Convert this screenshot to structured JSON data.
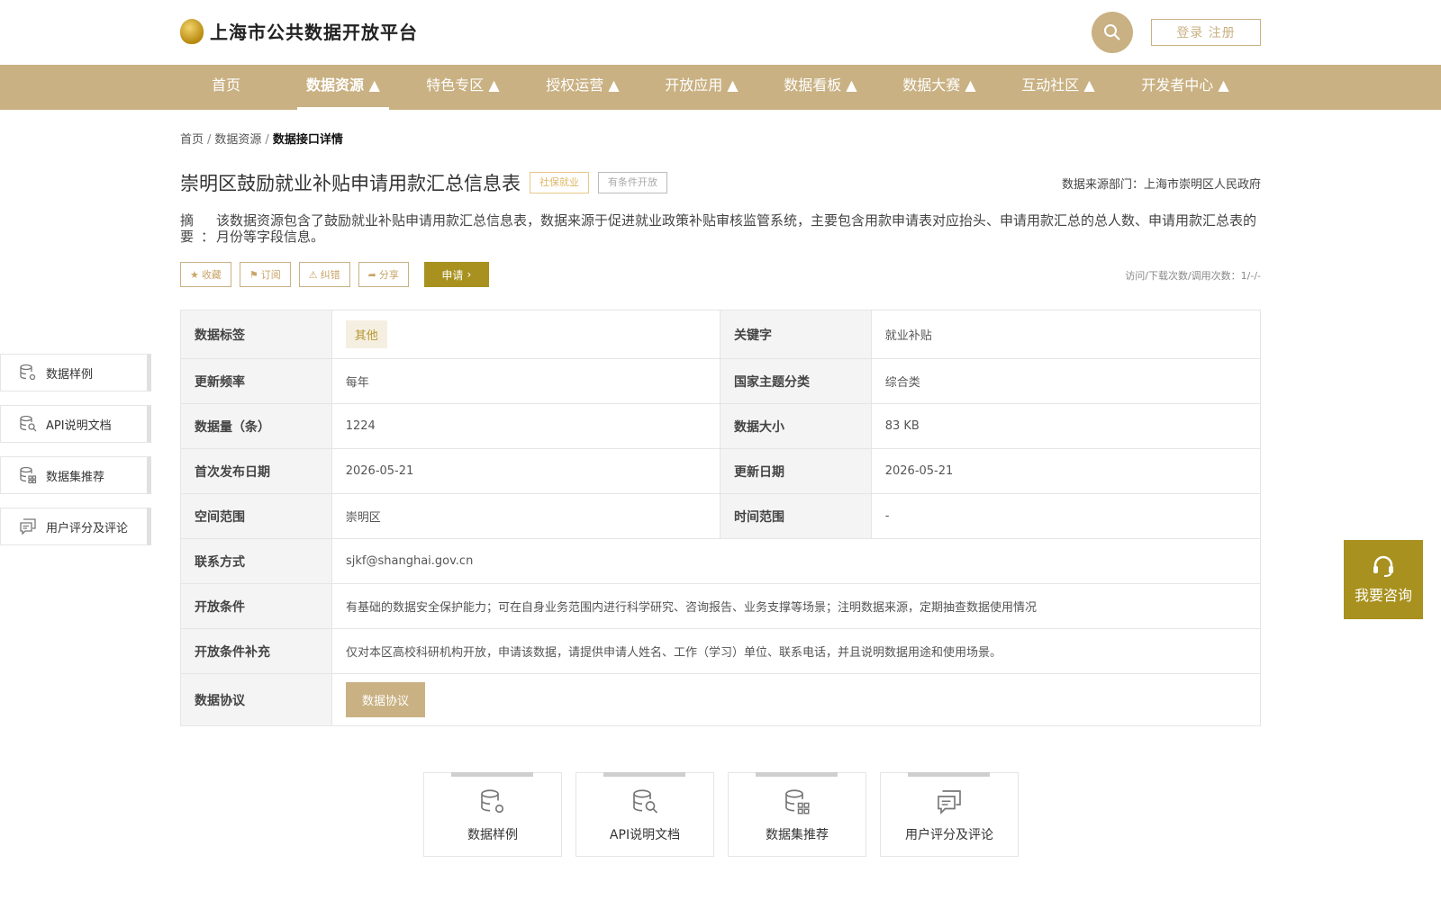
{
  "header": {
    "site_title": "上海市公共数据开放平台",
    "login_label": "登录 注册"
  },
  "nav": {
    "items": [
      {
        "label": "首页"
      },
      {
        "label": "数据资源 ▲"
      },
      {
        "label": "特色专区 ▲"
      },
      {
        "label": "授权运营 ▲"
      },
      {
        "label": "开放应用 ▲"
      },
      {
        "label": "数据看板 ▲"
      },
      {
        "label": "数据大赛 ▲"
      },
      {
        "label": "互动社区 ▲"
      },
      {
        "label": "开发者中心 ▲"
      }
    ],
    "active_index": 1
  },
  "breadcrumb": {
    "home": "首页",
    "sep": "/",
    "section": "数据资源",
    "current": "数据接口详情"
  },
  "detail": {
    "title": "崇明区鼓励就业补贴申请用款汇总信息表",
    "tag_category": "社保就业",
    "tag_open": "有条件开放",
    "source": "数据来源部门：上海市崇明区人民政府",
    "summary_label": "摘要：",
    "summary": "该数据资源包含了鼓励就业补贴申请用款汇总信息表，数据来源于促进就业政策补贴审核监管系统，主要包含用款申请表对应抬头、申请用款汇总的总人数、申请用款汇总表的月份等字段信息。"
  },
  "actions": {
    "favorite": "收藏",
    "subscribe": "订阅",
    "report": "纠错",
    "share": "分享",
    "apply": "申请",
    "stats": "访问/下载次数/调用次数：1/-/-"
  },
  "table": {
    "data_tag_label": "数据标签",
    "data_tag_value": "其他",
    "keyword_label": "关键字",
    "keyword_value": "就业补贴",
    "freq_label": "更新频率",
    "freq_value": "每年",
    "theme_label": "国家主题分类",
    "theme_value": "综合类",
    "count_label": "数据量（条）",
    "count_value": "1224",
    "size_label": "数据大小",
    "size_value": "83 KB",
    "first_pub_label": "首次发布日期",
    "first_pub_value": "2026-05-21",
    "updated_label": "更新日期",
    "updated_value": "2026-05-21",
    "space_label": "空间范围",
    "space_value": "崇明区",
    "time_label": "时间范围",
    "time_value": "-",
    "contact_label": "联系方式",
    "contact_value": "sjkf@shanghai.gov.cn",
    "cond_label": "开放条件",
    "cond_value": "有基础的数据安全保护能力；可在自身业务范围内进行科学研究、咨询报告、业务支撑等场景；注明数据来源，定期抽查数据使用情况",
    "cond_extra_label": "开放条件补充",
    "cond_extra_value": "仅对本区高校科研机构开放，申请该数据，请提供申请人姓名、工作（学习）单位、联系电话，并且说明数据用途和使用场景。",
    "protocol_label": "数据协议",
    "protocol_btn": "数据协议"
  },
  "side_menu": [
    {
      "label": "数据样例",
      "icon": "database-gear-icon"
    },
    {
      "label": "API说明文档",
      "icon": "database-search-icon"
    },
    {
      "label": "数据集推荐",
      "icon": "database-grid-icon"
    },
    {
      "label": "用户评分及评论",
      "icon": "comment-icon"
    }
  ],
  "cards": [
    {
      "label": "数据样例",
      "icon": "database-gear-icon"
    },
    {
      "label": "API说明文档",
      "icon": "database-search-icon"
    },
    {
      "label": "数据集推荐",
      "icon": "database-grid-icon"
    },
    {
      "label": "用户评分及评论",
      "icon": "comment-icon"
    }
  ],
  "consult": {
    "label": "我要咨询",
    "icon": "headset-icon"
  },
  "colors": {
    "brand": "#c9b183",
    "accent": "#a8911e"
  }
}
